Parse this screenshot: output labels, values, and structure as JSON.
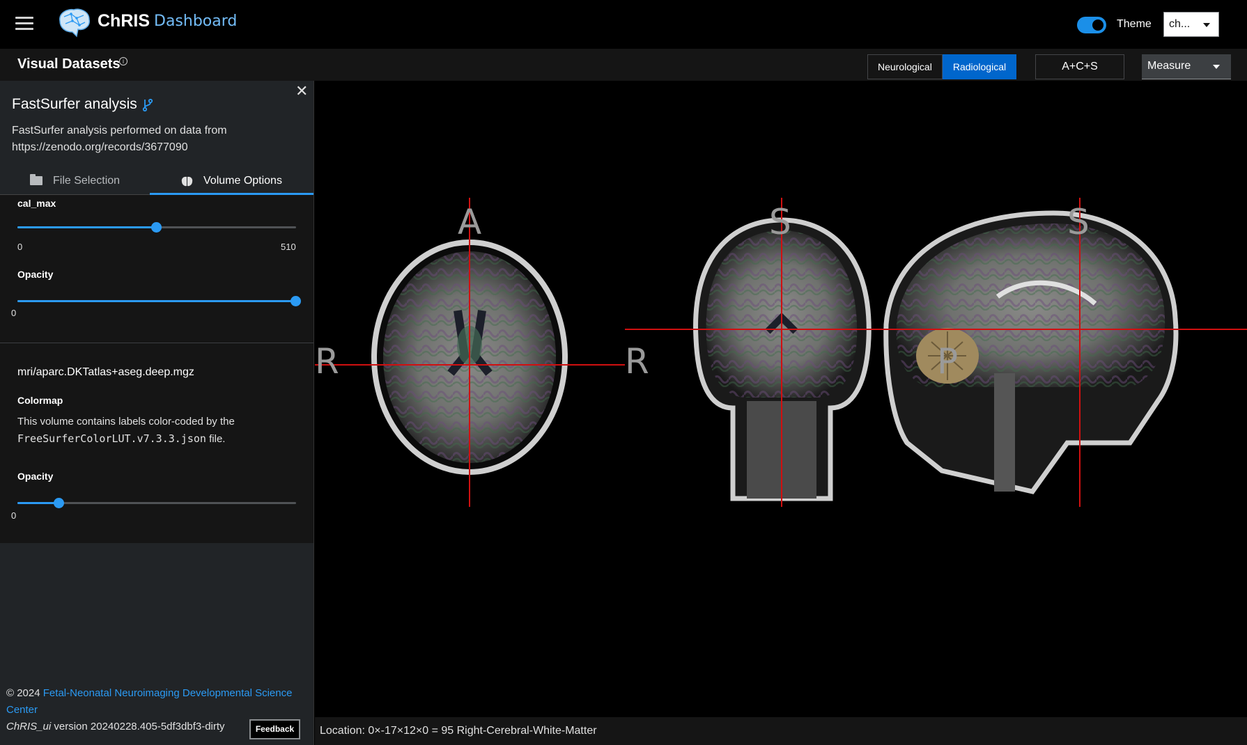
{
  "app": {
    "brand": "ChRIS",
    "brand_sub": "Dashboard",
    "theme_label": "Theme",
    "theme_value": "ch...",
    "theme_on": true,
    "accent": "#2b9af3"
  },
  "page": {
    "title": "Visual Datasets",
    "orientation_buttons": [
      "Neurological",
      "Radiological"
    ],
    "orientation_active": "Radiological",
    "layout_button": "A+C+S",
    "measure_select": "Measure"
  },
  "dataset": {
    "title": "FastSurfer analysis",
    "description": "FastSurfer analysis performed on data from https://zenodo.org/records/3677090",
    "tabs": [
      "File Selection",
      "Volume Options"
    ],
    "active_tab": "Volume Options"
  },
  "volume1": {
    "cal_max_label": "cal_max",
    "cal_max_min": "0",
    "cal_max_max": "510",
    "cal_max_fraction": 0.5,
    "opacity_label": "Opacity",
    "opacity_min": "0",
    "opacity_fraction": 1.0
  },
  "volume2": {
    "name": "mri/aparc.DKTatlas+aseg.deep.mgz",
    "colormap_label": "Colormap",
    "colormap_text_pre": "This volume contains labels color-coded by the",
    "colormap_file": "FreeSurferColorLUT.v7.3.3.json",
    "colormap_text_post": "file.",
    "opacity_label": "Opacity",
    "opacity_min": "0",
    "opacity_fraction": 0.15
  },
  "footer": {
    "copyright": "© 2024",
    "org_link": "Fetal-Neonatal Neuroimaging Developmental Science Center",
    "version_app": "ChRIS_ui",
    "version_text": "version 20240228.405-5df3dbf3-dirty",
    "feedback": "Feedback"
  },
  "viewer": {
    "labels": {
      "axial_top": "A",
      "axial_left": "R",
      "coronal_top": "S",
      "coronal_left": "R",
      "sagittal_top": "S",
      "sagittal_left": "P"
    },
    "crosshair_color": "#d01010"
  },
  "status": {
    "location": "Location: 0×-17×12×0 = 95 Right-Cerebral-White-Matter"
  }
}
